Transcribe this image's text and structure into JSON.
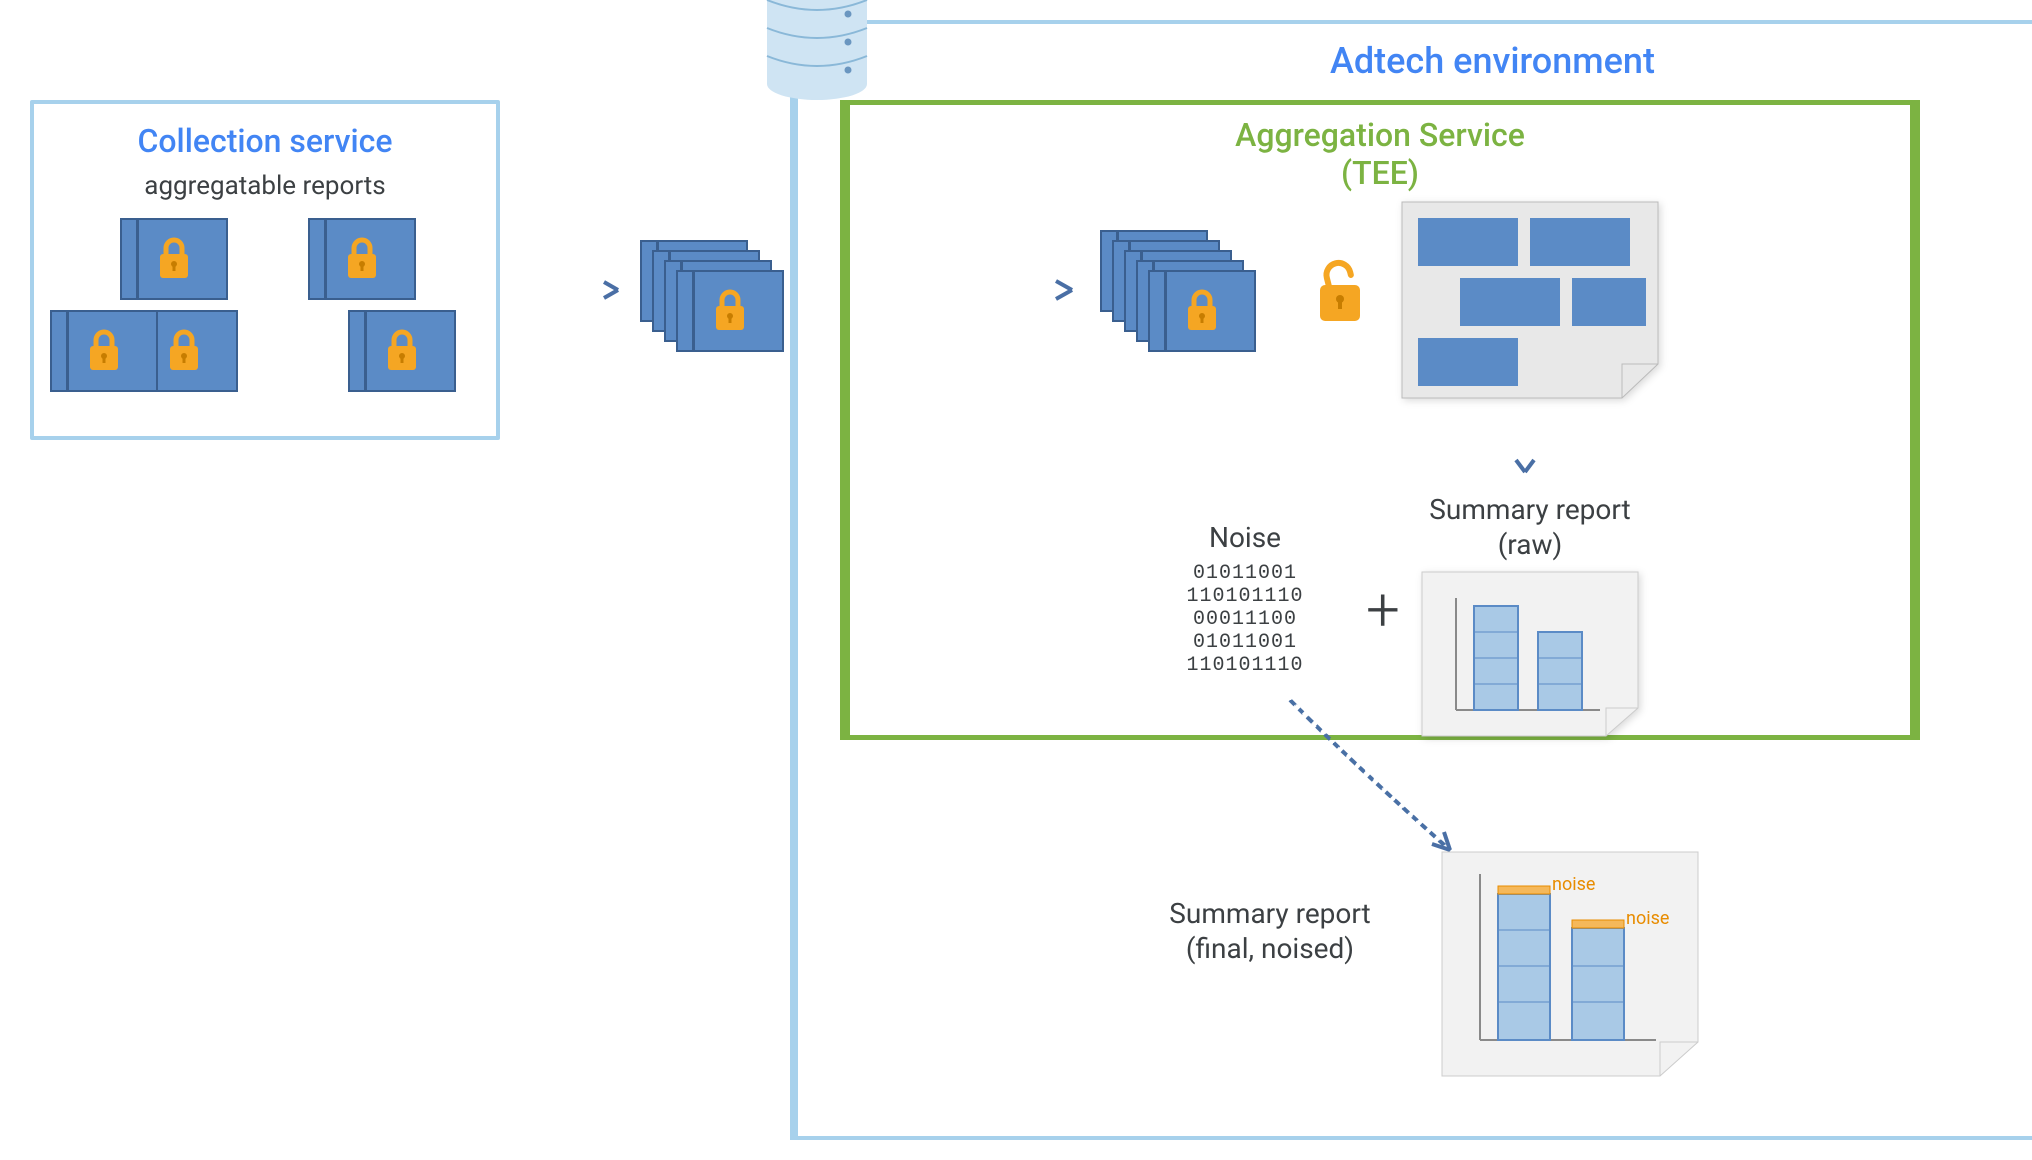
{
  "collection": {
    "title": "Collection service",
    "subtitle": "aggregatable reports"
  },
  "adtech": {
    "title": "Adtech environment"
  },
  "tee": {
    "title_line1": "Aggregation Service",
    "title_line2": "(TEE)"
  },
  "noise": {
    "label": "Noise",
    "bits": [
      "01011001",
      "110101110",
      "00011100",
      "01011001",
      "110101110"
    ]
  },
  "plus": "+",
  "summary_raw": {
    "label_line1": "Summary report",
    "label_line2": "(raw)"
  },
  "summary_final": {
    "label_line1": "Summary report",
    "label_line2": "(final, noised)",
    "noise_tag": "noise"
  },
  "icons": {
    "database": "database-icon",
    "locked_report": "locked-report-icon",
    "unlock": "unlock-icon"
  }
}
